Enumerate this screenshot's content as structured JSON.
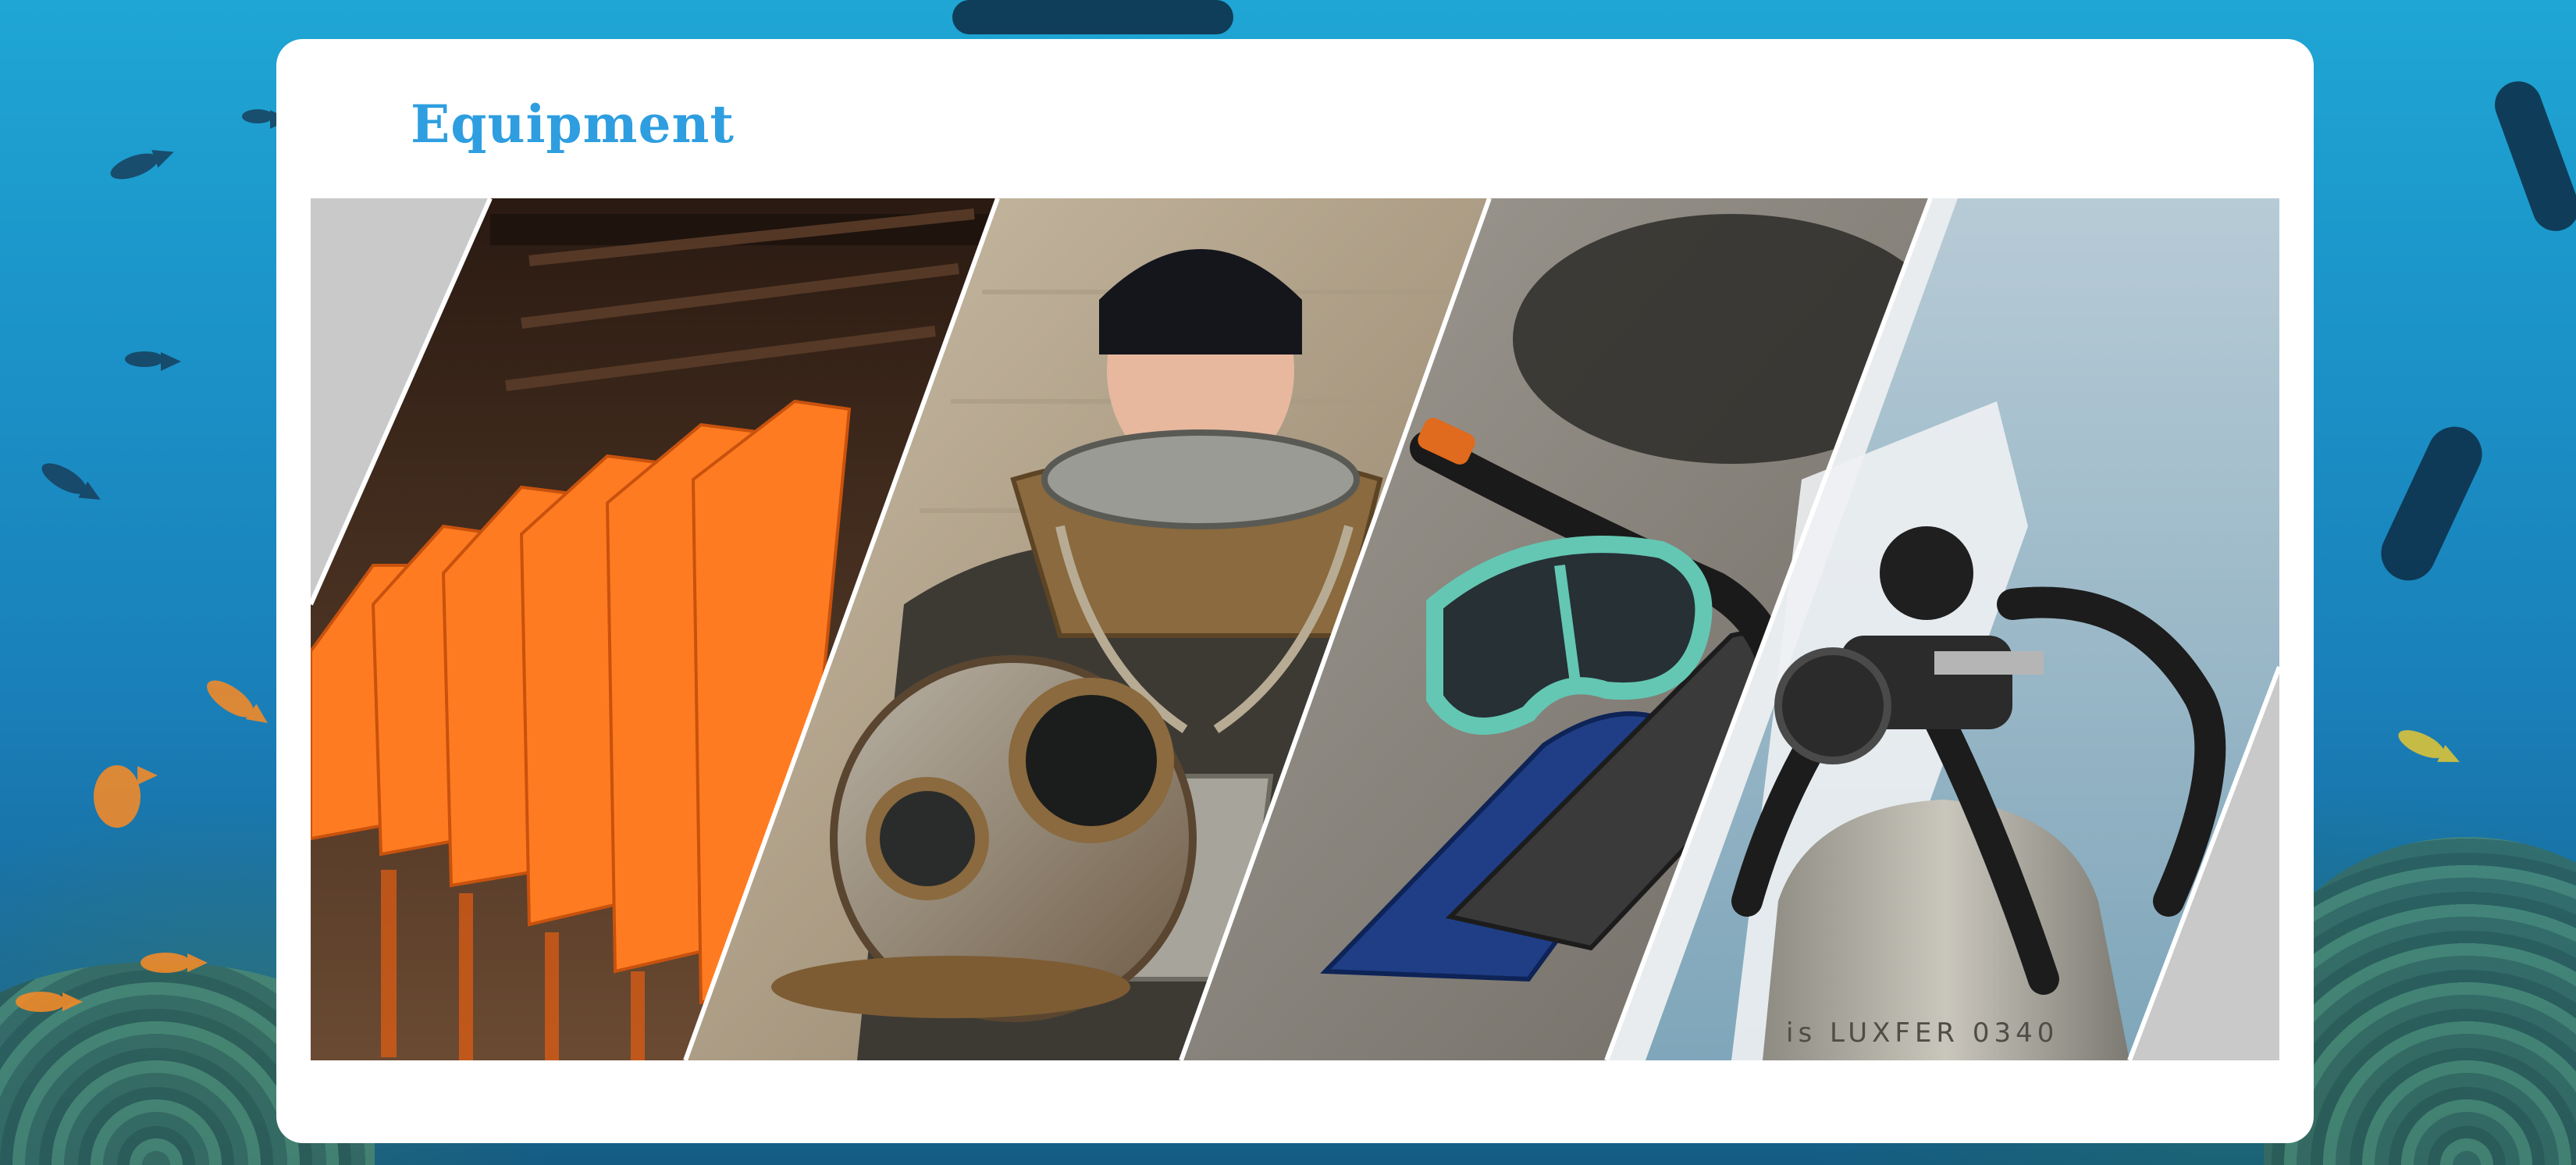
{
  "section": {
    "title": "Equipment"
  },
  "gallery": {
    "panels": [
      {
        "icon": "life-vests-photo"
      },
      {
        "icon": "diving-helmet-photo"
      },
      {
        "icon": "mask-snorkel-fins-photo"
      },
      {
        "icon": "scuba-tank-regulator-photo"
      }
    ],
    "tank_marking": "is LUXFER 0340"
  },
  "colors": {
    "title": "#2e9ee0",
    "card": "#ffffff",
    "gallery_bg": "#c9c9c9"
  }
}
